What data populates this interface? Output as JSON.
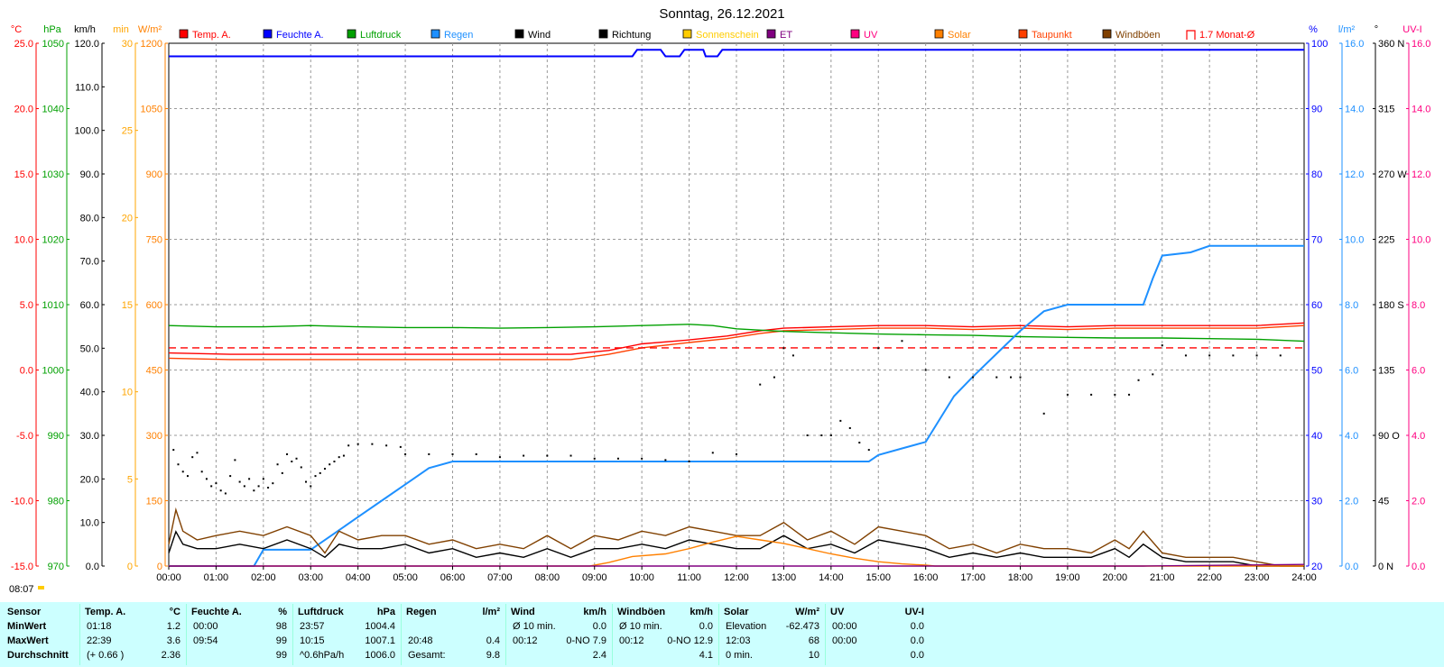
{
  "chart_data": {
    "type": "line",
    "title": "Sonntag, 26.12.2021",
    "x_labels": [
      "00:00",
      "01:00",
      "02:00",
      "03:00",
      "04:00",
      "05:00",
      "06:00",
      "07:00",
      "08:00",
      "09:00",
      "10:00",
      "11:00",
      "12:00",
      "13:00",
      "14:00",
      "15:00",
      "16:00",
      "17:00",
      "18:00",
      "19:00",
      "20:00",
      "21:00",
      "22:00",
      "23:00",
      "24:00"
    ],
    "xlim": [
      0,
      24
    ],
    "sunrise_label": "08:07",
    "legend": [
      {
        "label": "Temp. A.",
        "color": "#ff0000",
        "type": "box"
      },
      {
        "label": "Feuchte A.",
        "color": "#0000ff",
        "type": "box"
      },
      {
        "label": "Luftdruck",
        "color": "#00a000",
        "type": "box"
      },
      {
        "label": "Regen",
        "color": "#1e90ff",
        "type": "box"
      },
      {
        "label": "Wind",
        "color": "#000000",
        "type": "box"
      },
      {
        "label": "Richtung",
        "color": "#000000",
        "type": "box"
      },
      {
        "label": "Sonnenschein",
        "color": "#ffcc00",
        "type": "box"
      },
      {
        "label": "ET",
        "color": "#800080",
        "type": "box"
      },
      {
        "label": "UV",
        "color": "#ff0080",
        "type": "box"
      },
      {
        "label": "Solar",
        "color": "#ff8000",
        "type": "box"
      },
      {
        "label": "Taupunkt",
        "color": "#ff4000",
        "type": "box"
      },
      {
        "label": "Windböen",
        "color": "#804000",
        "type": "box"
      },
      {
        "label": "1.7 Monat-Ø",
        "color": "#ff0000",
        "type": "open"
      }
    ],
    "left_axes": [
      {
        "unit": "°C",
        "color": "#ff0000",
        "ticks": [
          "25.0",
          "20.0",
          "15.0",
          "10.0",
          "5.0",
          "0.0",
          "-5.0",
          "-10.0",
          "-15.0"
        ]
      },
      {
        "unit": "hPa",
        "color": "#00a000",
        "ticks": [
          "1050",
          "1040",
          "1030",
          "1020",
          "1010",
          "1000",
          "990",
          "980",
          "970"
        ]
      },
      {
        "unit": "km/h",
        "color": "#000000",
        "ticks": [
          "120.0",
          "110.0",
          "100.0",
          "90.0",
          "80.0",
          "70.0",
          "60.0",
          "50.0",
          "40.0",
          "30.0",
          "20.0",
          "10.0",
          "0.0"
        ]
      },
      {
        "unit": "min",
        "color": "#ffa500",
        "ticks": [
          "30",
          "25",
          "20",
          "15",
          "10",
          "5",
          "0"
        ]
      },
      {
        "unit": "W/m²",
        "color": "#ff8000",
        "ticks": [
          "1200",
          "1050",
          "900",
          "750",
          "600",
          "450",
          "300",
          "150",
          "0"
        ]
      }
    ],
    "right_axes": [
      {
        "unit": "%",
        "color": "#0000ff",
        "ticks": [
          "100",
          "90",
          "80",
          "70",
          "60",
          "50",
          "40",
          "30",
          "20"
        ]
      },
      {
        "unit": "l/m²",
        "color": "#1e90ff",
        "ticks": [
          "16.0",
          "14.0",
          "12.0",
          "10.0",
          "8.0",
          "6.0",
          "4.0",
          "2.0",
          "0.0"
        ]
      },
      {
        "unit": "°",
        "color": "#000000",
        "ticks": [
          "360 N",
          "315",
          "270 W",
          "225",
          "180 S",
          "135",
          "90 O",
          "45",
          "0 N"
        ]
      },
      {
        "unit": "UV-I",
        "color": "#ff0080",
        "ticks": [
          "16.0",
          "14.0",
          "12.0",
          "10.0",
          "8.0",
          "6.0",
          "4.0",
          "2.0",
          "0.0"
        ]
      }
    ],
    "series": [
      {
        "name": "Temp. A.",
        "color": "#ff0000",
        "unit": "°C",
        "ylim": [
          -15,
          25
        ],
        "x": [
          0,
          1.3,
          3,
          5,
          7,
          8.5,
          9.3,
          10,
          11,
          11.8,
          12.5,
          13,
          14,
          15,
          16,
          17,
          18,
          19,
          20,
          21,
          22,
          23,
          24
        ],
        "y": [
          1.3,
          1.2,
          1.2,
          1.2,
          1.2,
          1.2,
          1.5,
          2.0,
          2.3,
          2.6,
          3.0,
          3.2,
          3.3,
          3.4,
          3.4,
          3.3,
          3.4,
          3.3,
          3.4,
          3.4,
          3.4,
          3.4,
          3.6
        ]
      },
      {
        "name": "Taupunkt",
        "color": "#ff4000",
        "unit": "°C",
        "ylim": [
          -15,
          25
        ],
        "x": [
          0,
          1.3,
          3,
          5,
          7,
          8.5,
          9.3,
          10,
          11,
          11.8,
          12.5,
          13,
          14,
          15,
          16,
          17,
          18,
          19,
          20,
          21,
          22,
          23,
          24
        ],
        "y": [
          0.9,
          0.8,
          0.8,
          0.8,
          0.8,
          0.8,
          1.2,
          1.7,
          2.1,
          2.4,
          2.8,
          3.0,
          3.1,
          3.2,
          3.2,
          3.1,
          3.2,
          3.1,
          3.2,
          3.2,
          3.2,
          3.2,
          3.4
        ]
      },
      {
        "name": "1.7 Monat-Ø",
        "color": "#ff0000",
        "unit": "°C",
        "ylim": [
          -15,
          25
        ],
        "dashed": true,
        "x": [
          0,
          24
        ],
        "y": [
          1.7,
          1.7
        ]
      },
      {
        "name": "Feuchte A.",
        "color": "#0000ff",
        "unit": "%",
        "ylim": [
          20,
          100
        ],
        "x": [
          0,
          9.8,
          9.9,
          10.4,
          10.5,
          10.8,
          10.9,
          11.3,
          11.35,
          11.6,
          11.7,
          24
        ],
        "y": [
          98,
          98,
          99,
          99,
          98,
          98,
          99,
          99,
          98,
          98,
          99,
          99
        ]
      },
      {
        "name": "Luftdruck",
        "color": "#00a000",
        "unit": "hPa",
        "ylim": [
          970,
          1050
        ],
        "x": [
          0,
          1,
          2,
          3,
          4,
          5,
          6,
          7,
          8,
          9,
          10,
          11,
          11.5,
          12,
          13,
          14,
          15,
          16,
          17,
          18,
          19,
          20,
          21,
          22,
          23,
          24
        ],
        "y": [
          1006.8,
          1006.6,
          1006.6,
          1006.8,
          1006.6,
          1006.5,
          1006.5,
          1006.4,
          1006.5,
          1006.6,
          1006.8,
          1007.0,
          1006.8,
          1006.3,
          1005.9,
          1005.7,
          1005.5,
          1005.4,
          1005.3,
          1005.1,
          1005.0,
          1004.9,
          1004.9,
          1004.8,
          1004.7,
          1004.4
        ]
      },
      {
        "name": "Regen",
        "color": "#1e90ff",
        "unit": "l/m²",
        "ylim": [
          0,
          16
        ],
        "x": [
          0,
          1.8,
          2,
          3,
          3.5,
          4,
          4.5,
          5,
          5.5,
          6,
          7,
          8,
          9,
          10,
          11,
          12,
          13,
          14,
          14.8,
          15,
          15.5,
          16,
          16.3,
          16.6,
          17,
          17.5,
          18,
          18.5,
          19,
          19.5,
          20,
          20.6,
          20.8,
          21,
          21.6,
          22,
          23,
          24
        ],
        "y": [
          0,
          0,
          0.5,
          0.5,
          1.0,
          1.5,
          2.0,
          2.5,
          3.0,
          3.2,
          3.2,
          3.2,
          3.2,
          3.2,
          3.2,
          3.2,
          3.2,
          3.2,
          3.2,
          3.4,
          3.6,
          3.8,
          4.5,
          5.2,
          5.8,
          6.5,
          7.2,
          7.8,
          8.0,
          8.0,
          8.0,
          8.0,
          8.8,
          9.5,
          9.6,
          9.8,
          9.8,
          9.8
        ]
      },
      {
        "name": "Windböen",
        "color": "#804000",
        "unit": "km/h",
        "ylim": [
          0,
          120
        ],
        "x": [
          0,
          0.15,
          0.3,
          0.6,
          1,
          1.5,
          2,
          2.5,
          3,
          3.3,
          3.6,
          4,
          4.5,
          5,
          5.5,
          6,
          6.5,
          7,
          7.5,
          8,
          8.5,
          9,
          9.5,
          10,
          10.5,
          11,
          11.5,
          12,
          12.5,
          13,
          13.5,
          14,
          14.5,
          15,
          15.5,
          16,
          16.5,
          17,
          17.5,
          18,
          18.5,
          19,
          19.5,
          20,
          20.3,
          20.6,
          21,
          21.5,
          22,
          22.5,
          23,
          23.5,
          24
        ],
        "y": [
          5,
          12.9,
          8,
          6,
          7,
          8,
          7,
          9,
          7,
          3,
          8,
          6,
          7,
          7,
          5,
          6,
          4,
          5,
          4,
          7,
          4,
          7,
          6,
          8,
          7,
          9,
          8,
          7,
          7,
          10,
          6,
          8,
          5,
          9,
          8,
          7,
          4,
          5,
          3,
          5,
          4,
          4,
          3,
          6,
          4,
          8,
          3,
          2,
          2,
          2,
          1,
          0,
          0
        ]
      },
      {
        "name": "Wind",
        "color": "#000000",
        "unit": "km/h",
        "ylim": [
          0,
          120
        ],
        "x": [
          0,
          0.15,
          0.3,
          0.6,
          1,
          1.5,
          2,
          2.5,
          3,
          3.3,
          3.6,
          4,
          4.5,
          5,
          5.5,
          6,
          6.5,
          7,
          7.5,
          8,
          8.5,
          9,
          9.5,
          10,
          10.5,
          11,
          11.5,
          12,
          12.5,
          13,
          13.5,
          14,
          14.5,
          15,
          15.5,
          16,
          16.5,
          17,
          17.5,
          18,
          18.5,
          19,
          19.5,
          20,
          20.3,
          20.6,
          21,
          21.5,
          22,
          22.5,
          23,
          23.5,
          24
        ],
        "y": [
          3,
          7.9,
          5,
          4,
          4,
          5,
          4,
          6,
          4,
          2,
          5,
          4,
          4,
          5,
          3,
          4,
          2,
          3,
          2,
          4,
          2,
          4,
          4,
          5,
          4,
          6,
          5,
          4,
          4,
          7,
          4,
          5,
          3,
          6,
          5,
          4,
          2,
          3,
          2,
          3,
          2,
          2,
          2,
          4,
          2,
          5,
          2,
          1,
          1,
          1,
          0,
          0,
          0
        ]
      },
      {
        "name": "Solar",
        "color": "#ff8000",
        "unit": "W/m²",
        "ylim": [
          0,
          1200
        ],
        "x": [
          0,
          8.9,
          9.3,
          9.8,
          10.5,
          11,
          11.5,
          12,
          12.5,
          13,
          13.5,
          14,
          14.5,
          15,
          15.5,
          16,
          16.2,
          24
        ],
        "y": [
          0,
          0,
          8,
          22,
          28,
          40,
          55,
          68,
          60,
          52,
          40,
          28,
          18,
          10,
          5,
          2,
          0,
          0
        ]
      },
      {
        "name": "ET",
        "color": "#800080",
        "unit": "l/m²",
        "ylim": [
          0,
          16
        ],
        "x": [
          0,
          20.6,
          24
        ],
        "y": [
          0,
          0,
          0.05
        ]
      },
      {
        "name": "Richtung",
        "color": "#000000",
        "unit": "°",
        "ylim": [
          0,
          360
        ],
        "style": "dots",
        "x": [
          0.1,
          0.2,
          0.3,
          0.4,
          0.5,
          0.6,
          0.7,
          0.8,
          0.9,
          1.0,
          1.1,
          1.2,
          1.3,
          1.4,
          1.5,
          1.6,
          1.7,
          1.8,
          1.9,
          2.0,
          2.1,
          2.2,
          2.3,
          2.4,
          2.5,
          2.6,
          2.7,
          2.8,
          2.9,
          3.0,
          3.1,
          3.2,
          3.3,
          3.4,
          3.5,
          3.6,
          3.7,
          3.8,
          4.0,
          4.3,
          4.6,
          4.9,
          5.0,
          5.5,
          6.0,
          6.5,
          7.0,
          7.5,
          8.0,
          8.5,
          9.0,
          9.5,
          10.0,
          10.5,
          11.0,
          11.5,
          12.0,
          12.5,
          12.8,
          13.0,
          13.2,
          13.5,
          13.8,
          14.0,
          14.2,
          14.4,
          14.6,
          14.8,
          15.0,
          15.5,
          16.0,
          16.5,
          17.0,
          17.5,
          17.8,
          18.0,
          18.5,
          19.0,
          19.5,
          20.0,
          20.3,
          20.5,
          20.8,
          21.0,
          21.5,
          22.0,
          22.5,
          23.0,
          23.5
        ],
        "y": [
          80,
          70,
          65,
          62,
          75,
          78,
          65,
          60,
          55,
          57,
          52,
          50,
          62,
          73,
          58,
          55,
          60,
          52,
          55,
          60,
          54,
          57,
          70,
          64,
          77,
          72,
          74,
          68,
          58,
          55,
          62,
          64,
          67,
          70,
          72,
          75,
          76,
          83,
          84,
          84,
          83,
          82,
          77,
          77,
          77,
          77,
          75,
          76,
          76,
          76,
          74,
          74,
          74,
          73,
          72,
          78,
          77,
          125,
          130,
          150,
          145,
          90,
          90,
          90,
          100,
          95,
          85,
          80,
          150,
          155,
          135,
          130,
          130,
          130,
          130,
          130,
          105,
          118,
          118,
          118,
          118,
          128,
          132,
          152,
          145,
          145,
          145,
          145,
          145
        ]
      }
    ]
  },
  "stats": {
    "headers": [
      {
        "label": "Sensor",
        "unit": ""
      },
      {
        "label": "Temp. A.",
        "unit": "°C"
      },
      {
        "label": "Feuchte A.",
        "unit": "%"
      },
      {
        "label": "Luftdruck",
        "unit": "hPa"
      },
      {
        "label": "Regen",
        "unit": "l/m²"
      },
      {
        "label": "Wind",
        "unit": "km/h"
      },
      {
        "label": "Windböen",
        "unit": "km/h"
      },
      {
        "label": "Solar",
        "unit": "W/m²"
      },
      {
        "label": "UV",
        "unit": "UV-I"
      }
    ],
    "rows": [
      {
        "label": "MinWert",
        "cells": [
          {
            "a": "01:18",
            "b": "1.2"
          },
          {
            "a": "00:00",
            "b": "98"
          },
          {
            "a": "23:57",
            "b": "1004.4"
          },
          {
            "a": "",
            "b": ""
          },
          {
            "a": "Ø 10 min.",
            "b": "0.0"
          },
          {
            "a": "Ø 10 min.",
            "b": "0.0"
          },
          {
            "a": "Elevation",
            "b": "-62.473"
          },
          {
            "a": "00:00",
            "b": "0.0"
          }
        ]
      },
      {
        "label": "MaxWert",
        "cells": [
          {
            "a": "22:39",
            "b": "3.6"
          },
          {
            "a": "09:54",
            "b": "99"
          },
          {
            "a": "10:15",
            "b": "1007.1"
          },
          {
            "a": "20:48",
            "b": "0.4"
          },
          {
            "a": "00:12",
            "b": "0-NO 7.9"
          },
          {
            "a": "00:12",
            "b": "0-NO 12.9"
          },
          {
            "a": "12:03",
            "b": "68"
          },
          {
            "a": "00:00",
            "b": "0.0"
          }
        ]
      },
      {
        "label": "Durchschnitt",
        "cells": [
          {
            "a": "(+ 0.66 )",
            "b": "2.36"
          },
          {
            "a": "",
            "b": "99"
          },
          {
            "a": "^0.6hPa/h",
            "b": "1006.0"
          },
          {
            "a": "Gesamt:",
            "b": "9.8"
          },
          {
            "a": "",
            "b": "2.4"
          },
          {
            "a": "",
            "b": "4.1"
          },
          {
            "a": "0 min.",
            "b": "10"
          },
          {
            "a": "",
            "b": "0.0"
          }
        ]
      }
    ]
  }
}
